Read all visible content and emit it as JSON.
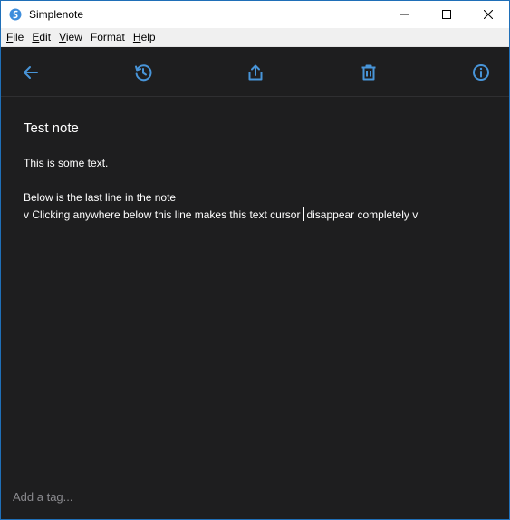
{
  "window": {
    "title": "Simplenote",
    "accent_color": "#4895d9",
    "background_color": "#1e1e1f"
  },
  "menu": [
    {
      "accel": "F",
      "rest": "ile"
    },
    {
      "accel": "E",
      "rest": "dit"
    },
    {
      "accel": "V",
      "rest": "iew"
    },
    {
      "accel": "",
      "rest": "Format"
    },
    {
      "accel": "H",
      "rest": "elp"
    }
  ],
  "toolbar": {
    "icons": [
      "back-arrow-icon",
      "history-icon",
      "share-icon",
      "trash-icon",
      "info-icon"
    ]
  },
  "note": {
    "title": "Test note",
    "line1": "This is some text.",
    "line2": "Below is the last line in the note",
    "line3_before_cursor": "v Clicking anywhere below this line makes this text cursor",
    "line3_after_cursor": "disappear completely v"
  },
  "tags": {
    "placeholder": "Add a tag..."
  }
}
